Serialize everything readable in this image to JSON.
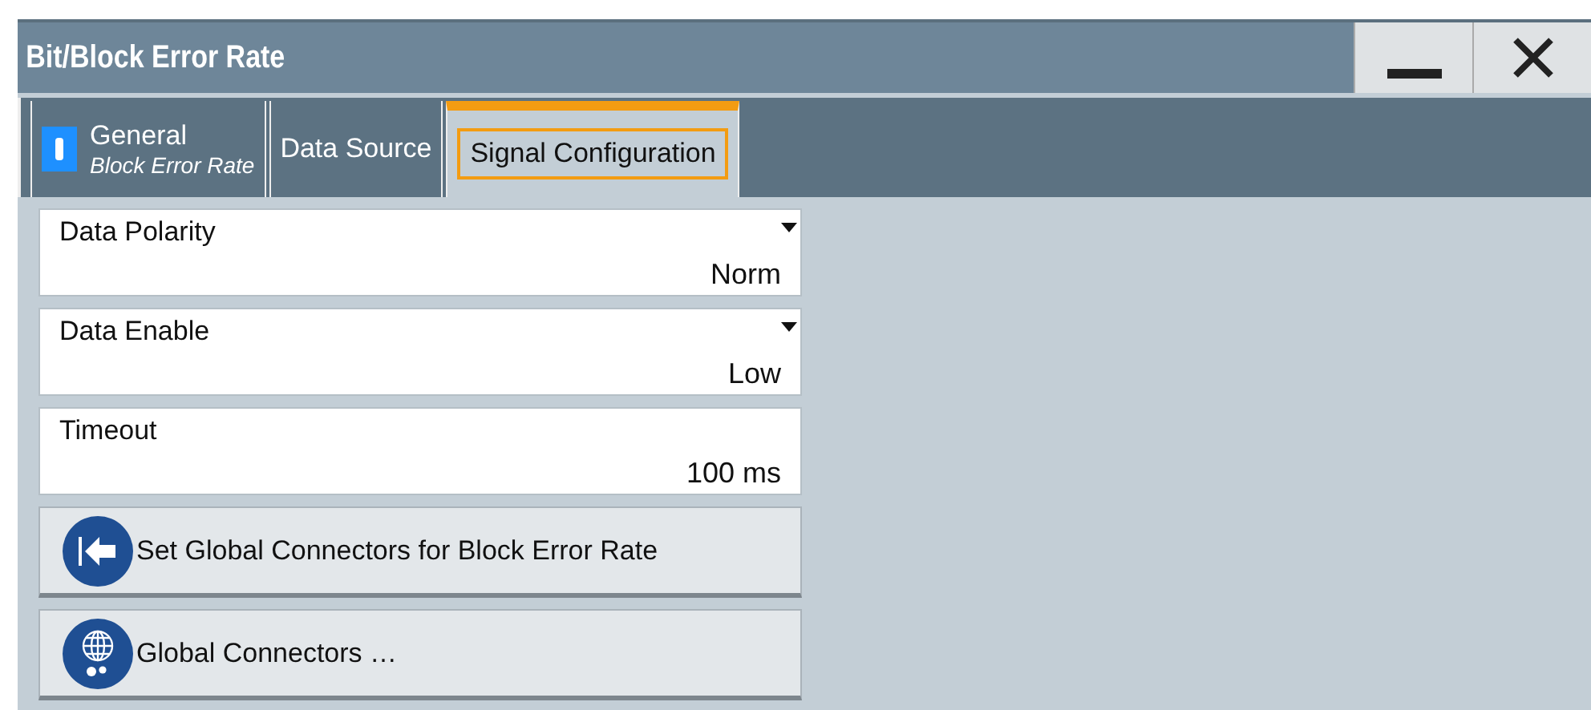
{
  "window": {
    "title": "Bit/Block Error Rate"
  },
  "tabs": [
    {
      "kind": "general",
      "label": "General",
      "sublabel": "Block Error Rate",
      "selected": false
    },
    {
      "kind": "plain",
      "label": "Data Source",
      "selected": false
    },
    {
      "kind": "plain",
      "label": "Signal Configuration",
      "selected": true
    }
  ],
  "fields": [
    {
      "kind": "dropdown",
      "label": "Data Polarity",
      "value": "Norm"
    },
    {
      "kind": "dropdown",
      "label": "Data Enable",
      "value": "Low"
    },
    {
      "kind": "input",
      "label": "Timeout",
      "value": "100 ms"
    }
  ],
  "buttons": [
    {
      "kind": "arrow",
      "label": "Set Global Connectors for Block Error Rate"
    },
    {
      "kind": "globe",
      "label": "Global Connectors …"
    }
  ]
}
